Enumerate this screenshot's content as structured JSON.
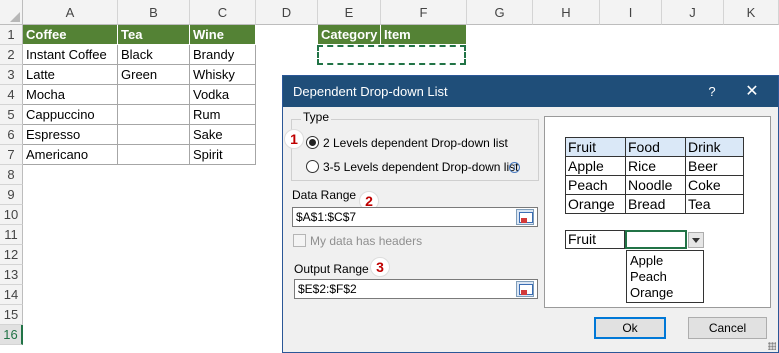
{
  "spreadsheet": {
    "columns": [
      "A",
      "B",
      "C",
      "D",
      "E",
      "F",
      "G",
      "H",
      "I",
      "J",
      "K"
    ],
    "rows": [
      "1",
      "2",
      "3",
      "4",
      "5",
      "6",
      "7",
      "8",
      "9",
      "10",
      "11",
      "12",
      "13",
      "14",
      "15",
      "16"
    ],
    "selected_row": "16",
    "headers": {
      "a": "Coffee",
      "b": "Tea",
      "c": "Wine",
      "e": "Category",
      "f": "Item"
    },
    "col_a": [
      "Instant Coffee",
      "Latte",
      "Mocha",
      "Cappuccino",
      "Espresso",
      "Americano"
    ],
    "col_b": [
      "Black",
      "Green"
    ],
    "col_c": [
      "Brandy",
      "Whisky",
      "Vodka",
      "Rum",
      "Sake",
      "Spirit"
    ]
  },
  "dialog": {
    "title": "Dependent Drop-down List",
    "help_glyph": "?",
    "close_glyph": "✕",
    "type_label": "Type",
    "radio_2_levels": "2 Levels dependent Drop-down list",
    "radio_3_5_levels": "3-5 Levels dependent Drop-down list",
    "info_glyph": "i",
    "data_range_label": "Data Range",
    "data_range_value": "$A$1:$C$7",
    "headers_checkbox_label": "My data has headers",
    "output_range_label": "Output Range",
    "output_range_value": "$E$2:$F$2",
    "badges": [
      "1",
      "2",
      "3"
    ],
    "ok_label": "Ok",
    "cancel_label": "Cancel"
  },
  "preview": {
    "header": [
      "Fruit",
      "Food",
      "Drink"
    ],
    "rows": [
      [
        "Apple",
        "Rice",
        "Beer"
      ],
      [
        "Peach",
        "Noodle",
        "Coke"
      ],
      [
        "Orange",
        "Bread",
        "Tea"
      ]
    ],
    "dropdown_value": "Fruit",
    "dropdown_items": [
      "Apple",
      "Peach",
      "Orange"
    ]
  },
  "colors": {
    "header_fill": "#548235",
    "titlebar": "#1f4e79",
    "badge_text": "#c00000",
    "excel_green": "#217346"
  }
}
